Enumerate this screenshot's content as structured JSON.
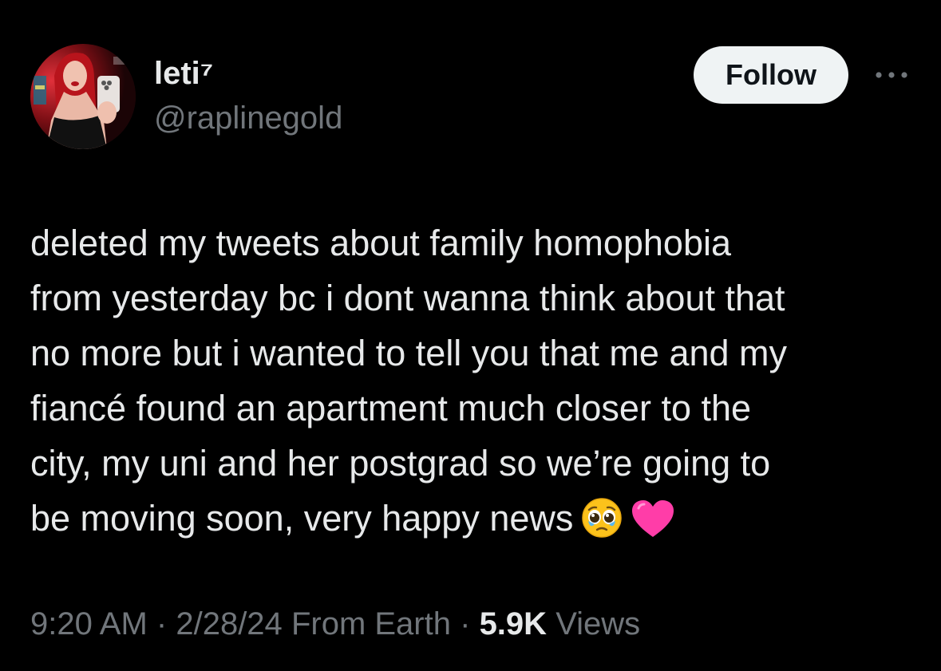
{
  "user": {
    "display_name": "leti⁷",
    "handle": "@raplinegold",
    "avatar_icon": "profile-photo"
  },
  "actions": {
    "follow_label": "Follow",
    "more_icon": "more-horizontal-icon"
  },
  "tweet": {
    "lines": [
      "deleted my tweets about family homophobia",
      "from yesterday bc i dont wanna think about that",
      "no more but i wanted to tell you that me and my",
      "fiancé found an apartment much closer to the",
      "city, my uni and her postgrad so we’re going to",
      "be moving soon, very happy news"
    ],
    "emojis": [
      "pleading-face-with-tears",
      "pink-heart"
    ]
  },
  "meta": {
    "time": "9:20 AM",
    "separator": "·",
    "date": "2/28/24",
    "source": "From Earth",
    "views_count": "5.9K",
    "views_label": "Views"
  },
  "colors": {
    "background": "#000000",
    "primary_text": "#e7e9ea",
    "secondary_text": "#71767b",
    "follow_button_bg": "#eff3f4",
    "follow_button_text": "#0f1419",
    "heart": "#ff3da8"
  }
}
